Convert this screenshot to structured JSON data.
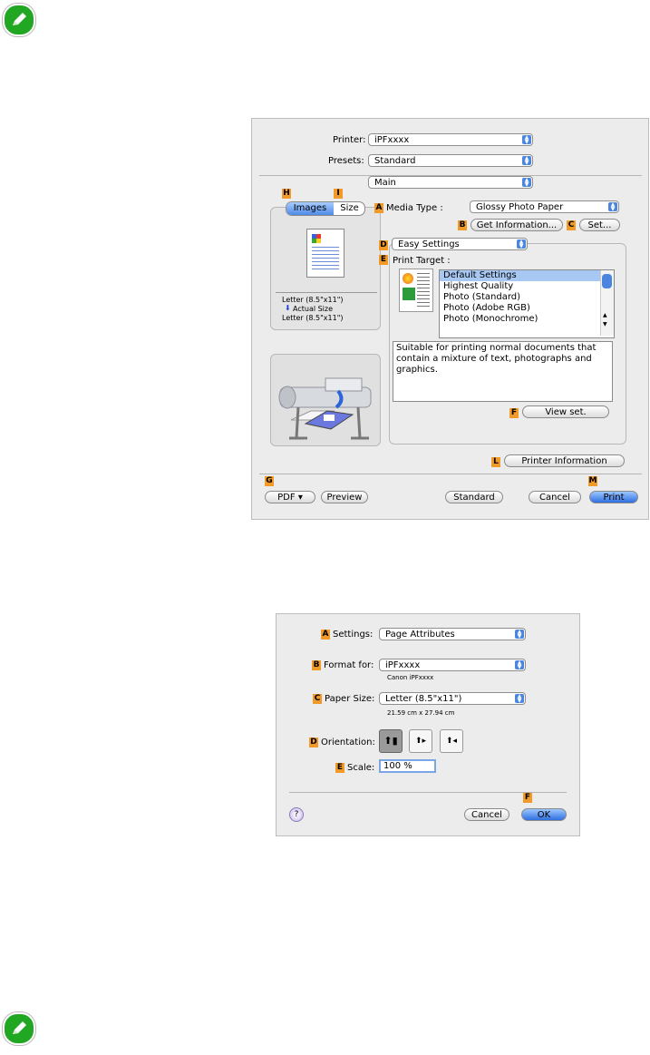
{
  "print_dialog": {
    "printer_label": "Printer:",
    "printer_value": "iPFxxxx",
    "presets_label": "Presets:",
    "presets_value": "Standard",
    "panel_value": "Main",
    "tab_images": "Images",
    "tab_size": "Size",
    "media_type_label": "Media Type :",
    "media_type_value": "Glossy Photo Paper",
    "get_info_button": "Get Information...",
    "set_button": "Set...",
    "easy_settings_value": "Easy Settings",
    "print_target_label": "Print Target :",
    "print_target_items": [
      "Default Settings",
      "Highest Quality",
      "Photo (Standard)",
      "Photo (Adobe RGB)",
      "Photo (Monochrome)"
    ],
    "description": "Suitable for printing normal documents that contain a mixture of text, photographs and graphics.",
    "view_set_button": "View set.",
    "printer_info_button": "Printer Information",
    "preview_line1": "Letter (8.5\"x11\")",
    "preview_line2": "Actual Size",
    "preview_line3": "Letter (8.5\"x11\")",
    "pdf_button": "PDF ▾",
    "preview_button": "Preview",
    "standard_button": "Standard",
    "cancel_button": "Cancel",
    "print_button": "Print",
    "keys": {
      "A": "A",
      "B": "B",
      "C": "C",
      "D": "D",
      "E": "E",
      "F": "F",
      "G": "G",
      "H": "H",
      "I": "I",
      "L": "L",
      "M": "M"
    }
  },
  "page_setup": {
    "settings_label": "Settings:",
    "settings_value": "Page Attributes",
    "format_label": "Format for:",
    "format_value": "iPFxxxx",
    "format_sub": "Canon iPFxxxx",
    "paper_label": "Paper Size:",
    "paper_value": "Letter (8.5\"x11\")",
    "paper_sub": "21.59 cm x 27.94 cm",
    "orientation_label": "Orientation:",
    "scale_label": "Scale:",
    "scale_value": "100 %",
    "help_label": "?",
    "cancel_button": "Cancel",
    "ok_button": "OK",
    "keys": {
      "A": "A",
      "B": "B",
      "C": "C",
      "D": "D",
      "E": "E",
      "F": "F"
    }
  },
  "colors": {
    "accent": "#f29a27",
    "note": "#22a722",
    "select": "#a8c8f4"
  },
  "icons": [
    "note-pencil-icon",
    "popup-arrow-icon",
    "printer-illustration",
    "page-thumbnail",
    "orientation-portrait-icon",
    "orientation-landscape-icon",
    "orientation-reverse-landscape-icon",
    "help-icon"
  ]
}
